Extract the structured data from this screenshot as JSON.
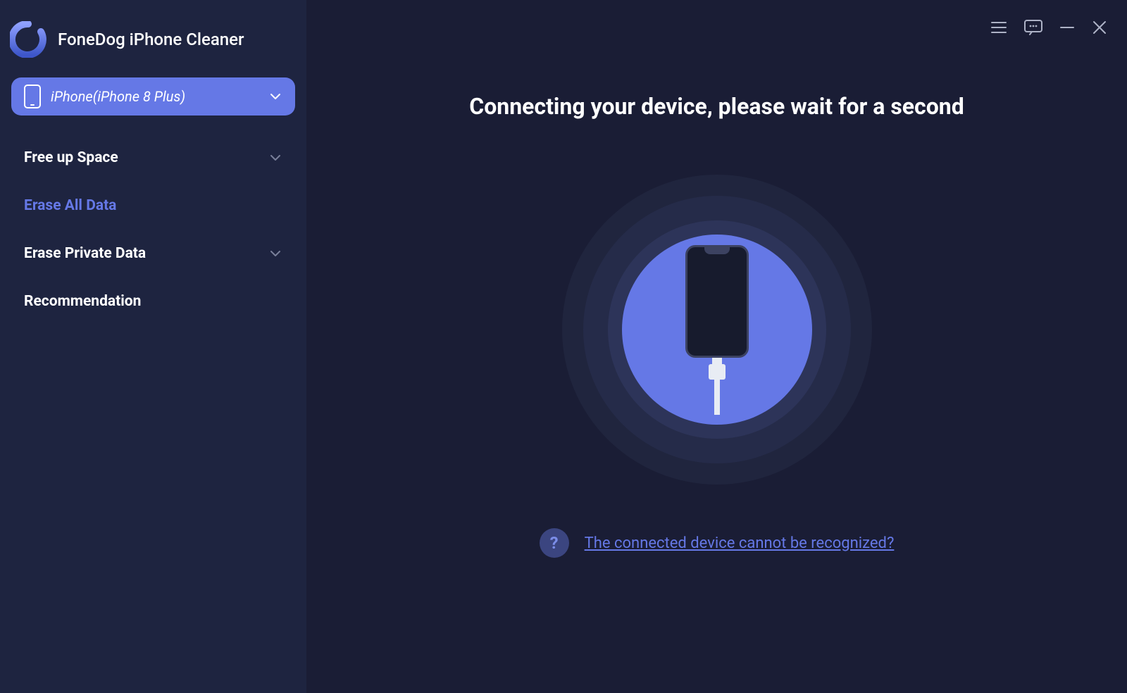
{
  "brand": {
    "title": "FoneDog iPhone Cleaner"
  },
  "device": {
    "label": "iPhone(iPhone 8 Plus)"
  },
  "nav": {
    "free_up_space": "Free up Space",
    "erase_all_data": "Erase All Data",
    "erase_private_data": "Erase Private Data",
    "recommendation": "Recommendation"
  },
  "main": {
    "headline": "Connecting your device, please wait for a second",
    "help_link": "The connected device cannot be recognized?",
    "help_badge": "?"
  }
}
